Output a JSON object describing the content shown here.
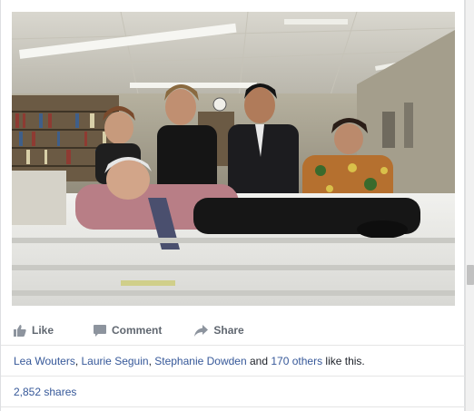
{
  "post": {
    "photo_alt": "Group photo: a man in a pink shirt reclining on a hospital bed while colleagues pose around him",
    "actions": {
      "like": "Like",
      "comment": "Comment",
      "share": "Share"
    },
    "likes": {
      "names": [
        "Lea Wouters",
        "Laurie Seguin",
        "Stephanie Dowden"
      ],
      "sep1": ", ",
      "sep2": ", ",
      "and_text": " and ",
      "others_link": "170 others",
      "suffix": " like this."
    },
    "shares": "2,852 shares"
  },
  "colors": {
    "link": "#365899",
    "action_gray": "#606770",
    "divider": "#e5e5e5"
  },
  "icons": [
    "like-icon",
    "comment-icon",
    "share-icon"
  ]
}
